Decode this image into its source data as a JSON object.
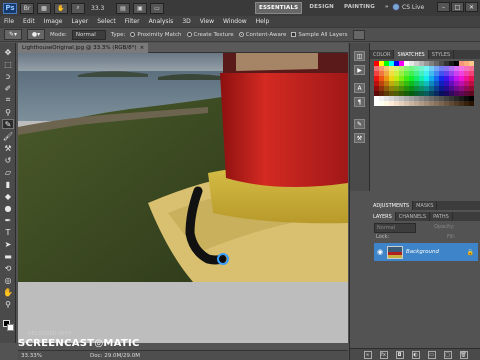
{
  "app": {
    "logo": "Ps",
    "zoom": "33.3",
    "workspaces": [
      "ESSENTIALS",
      "DESIGN",
      "PAINTING",
      "»"
    ],
    "cs_live": "CS Live",
    "window_controls": [
      "–",
      "□",
      "✕"
    ]
  },
  "menu": [
    "File",
    "Edit",
    "Image",
    "Layer",
    "Select",
    "Filter",
    "Analysis",
    "3D",
    "View",
    "Window",
    "Help"
  ],
  "options": {
    "mode_label": "Mode:",
    "mode_value": "Normal",
    "type_label": "Type:",
    "type_options": [
      {
        "label": "Proximity Match",
        "selected": false
      },
      {
        "label": "Create Texture",
        "selected": false
      },
      {
        "label": "Content-Aware",
        "selected": true
      }
    ],
    "sample_all_layers": "Sample All Layers"
  },
  "document": {
    "tab_title": "LighthouseOriginal.jpg @ 33.3% (RGB/8*)",
    "close": "×"
  },
  "status": {
    "zoom": "33.33%",
    "doc_size": "Doc: 29.0M/29.0M"
  },
  "watermark": {
    "recorded_with": "RECORDED WITH",
    "brand": "SCREENCAST",
    "brand_suffix": "MATIC"
  },
  "panels": {
    "color_tabs": [
      "COLOR",
      "SWATCHES",
      "STYLES"
    ],
    "adjust_tabs": [
      "ADJUSTMENTS",
      "MASKS"
    ],
    "layer_tabs": [
      "LAYERS",
      "CHANNELS",
      "PATHS"
    ],
    "blend_mode": "Normal",
    "opacity_label": "Opacity:",
    "lock_label": "Lock:",
    "fill_label": "Fill:",
    "layer_name": "Background"
  },
  "colors": {
    "accent": "#3e84c8",
    "chrome_dark": "#3a3a3a"
  }
}
